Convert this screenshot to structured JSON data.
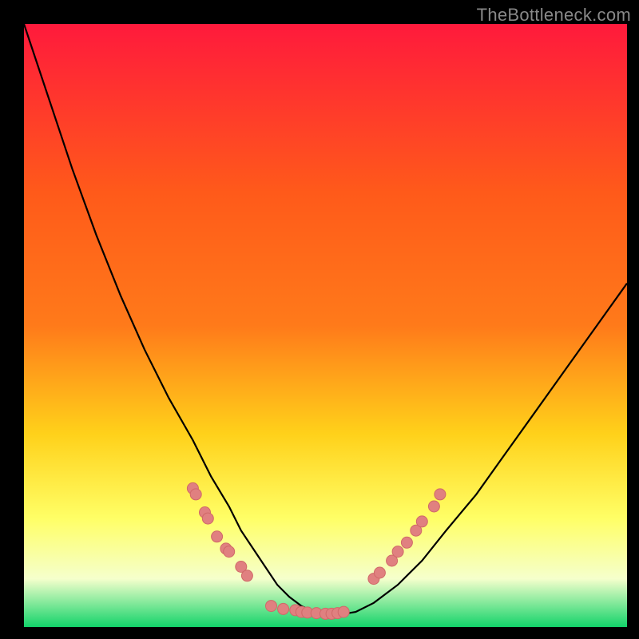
{
  "watermark": "TheBottleneck.com",
  "colors": {
    "curve_stroke": "#000000",
    "marker_fill": "#e08080",
    "marker_stroke": "#d06868",
    "frame_bg": "#000000",
    "grad_top": "#ff1a3c",
    "grad_mid1": "#ff7a1a",
    "grad_mid2": "#ffd11a",
    "grad_mid3": "#ffff66",
    "grad_mid4": "#f5ffcc",
    "grad_bottom": "#12d36a"
  },
  "chart_data": {
    "type": "line",
    "title": "",
    "xlabel": "",
    "ylabel": "",
    "xlim": [
      0,
      100
    ],
    "ylim": [
      0,
      100
    ],
    "legend": false,
    "grid": false,
    "background": "rainbow-vertical-gradient",
    "series": [
      {
        "name": "bottleneck-curve",
        "kind": "line",
        "x": [
          0,
          4,
          8,
          12,
          16,
          20,
          24,
          28,
          31,
          34,
          36,
          38,
          40,
          42,
          44,
          46,
          48,
          50,
          52,
          55,
          58,
          62,
          66,
          70,
          75,
          80,
          85,
          90,
          95,
          100
        ],
        "y": [
          100,
          88,
          76,
          65,
          55,
          46,
          38,
          31,
          25,
          20,
          16,
          13,
          10,
          7,
          5,
          3.5,
          2.5,
          2,
          2,
          2.5,
          4,
          7,
          11,
          16,
          22,
          29,
          36,
          43,
          50,
          57
        ]
      },
      {
        "name": "points-left",
        "kind": "scatter",
        "x": [
          28,
          28.5,
          30,
          30.5,
          32,
          33.5,
          34,
          36,
          37
        ],
        "y": [
          23,
          22,
          19,
          18,
          15,
          13,
          12.5,
          10,
          8.5
        ]
      },
      {
        "name": "points-bottom",
        "kind": "scatter",
        "x": [
          41,
          43,
          45,
          46,
          47,
          48.5,
          50,
          51,
          52,
          53
        ],
        "y": [
          3.5,
          3,
          2.8,
          2.5,
          2.4,
          2.3,
          2.2,
          2.2,
          2.3,
          2.5
        ]
      },
      {
        "name": "points-right",
        "kind": "scatter",
        "x": [
          58,
          59,
          61,
          62,
          63.5,
          65,
          66,
          68,
          69
        ],
        "y": [
          8,
          9,
          11,
          12.5,
          14,
          16,
          17.5,
          20,
          22
        ]
      }
    ]
  }
}
